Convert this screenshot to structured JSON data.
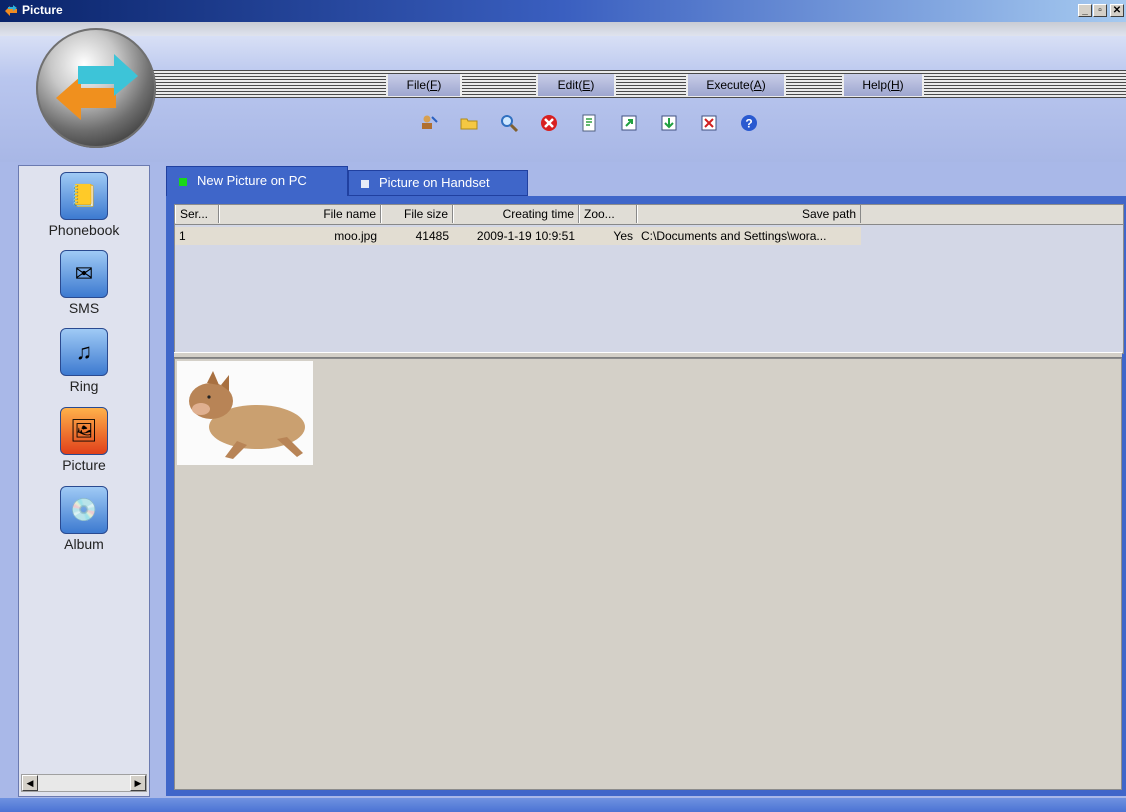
{
  "window": {
    "title": "Picture",
    "controls": {
      "minimize": "_",
      "maximize": "🗗",
      "close": "✕"
    }
  },
  "menu": {
    "items": [
      {
        "label": "File(",
        "key": "F",
        "end": ")"
      },
      {
        "label": "Edit(",
        "key": "E",
        "end": ")"
      },
      {
        "label": "Execute(",
        "key": "A",
        "end": ")"
      },
      {
        "label": "Help(",
        "key": "H",
        "end": ")"
      }
    ]
  },
  "toolbar": {
    "icons": [
      "new-contact-icon",
      "open-folder-icon",
      "search-icon",
      "delete-icon",
      "import-icon",
      "export-icon",
      "download-icon",
      "remove-icon",
      "help-icon"
    ]
  },
  "sidebar": {
    "items": [
      {
        "label": "Phonebook",
        "icon": "phonebook-icon",
        "glyph": "📒"
      },
      {
        "label": "SMS",
        "icon": "sms-icon",
        "glyph": "✉"
      },
      {
        "label": "Ring",
        "icon": "ring-icon",
        "glyph": "♫"
      },
      {
        "label": "Picture",
        "icon": "picture-icon",
        "glyph": "🖼"
      },
      {
        "label": "Album",
        "icon": "album-icon",
        "glyph": "💿"
      }
    ],
    "scroll_left": "◀",
    "scroll_right": "▶"
  },
  "tabs": [
    {
      "label": "New Picture on PC",
      "dot_color": "#19d819"
    },
    {
      "label": "Picture on Handset",
      "dot_color": "#e8ecf8"
    }
  ],
  "table": {
    "columns": [
      "Ser...",
      "File name",
      "File size",
      "Creating time",
      "Zoo...",
      "Save path"
    ],
    "rows": [
      [
        "1",
        "moo.jpg",
        "41485",
        "2009-1-19 10:9:51",
        "Yes",
        "C:\\Documents and Settings\\wora..."
      ]
    ]
  },
  "colors": {
    "accent": "#3f66c9",
    "header": "#a8b7e6"
  }
}
